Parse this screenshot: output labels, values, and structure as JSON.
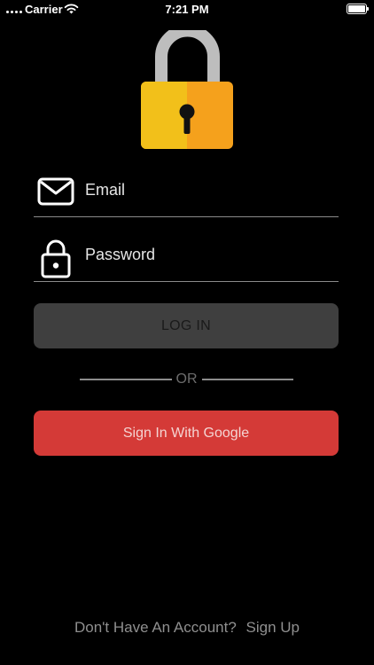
{
  "status_bar": {
    "carrier": "Carrier",
    "time": "7:21 PM"
  },
  "colors": {
    "background": "#000000",
    "lock_shackle": "#bdbdbd",
    "lock_body_left": "#f2c01a",
    "lock_body_right": "#f5a11c",
    "login_button": "#3f3f3f",
    "google_button": "#d43a37",
    "divider": "#8c8c8c"
  },
  "form": {
    "email_placeholder": "Email",
    "password_placeholder": "Password",
    "login_label": "LOG IN",
    "or_label": "OR",
    "google_label": "Sign In With Google"
  },
  "footer": {
    "prompt": "Don't Have An Account?",
    "signup_label": "Sign Up"
  },
  "icons": {
    "logo": "padlock-logo",
    "email": "envelope-icon",
    "password": "lock-icon"
  }
}
